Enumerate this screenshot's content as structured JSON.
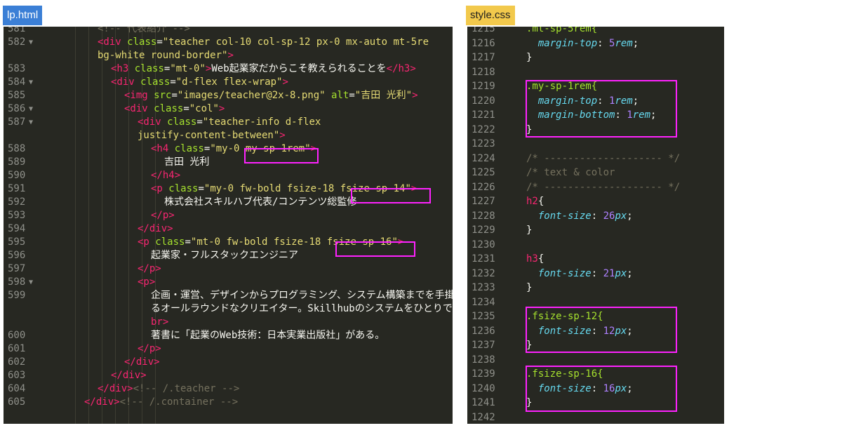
{
  "tabs": {
    "left": "lp.html",
    "right": "style.css"
  },
  "html_lines": [
    {
      "n": "581",
      "fold": "",
      "indent": 2,
      "tokens": [
        [
          "cm",
          "<!-- 代表紹介 -->"
        ]
      ]
    },
    {
      "n": "582",
      "fold": "▼",
      "indent": 2,
      "tokens": [
        [
          "tag",
          "<div"
        ],
        [
          "txt",
          " "
        ],
        [
          "attr",
          "class"
        ],
        [
          "txt",
          "="
        ],
        [
          "str",
          "\"teacher col-10 col-sp-12 px-0 mx-auto mt-5re"
        ]
      ]
    },
    {
      "n": "",
      "fold": "",
      "indent": 2,
      "tokens": [
        [
          "str",
          "bg-white round-border\""
        ],
        [
          "tag",
          ">"
        ]
      ]
    },
    {
      "n": "583",
      "fold": "",
      "indent": 3,
      "tokens": [
        [
          "tag",
          "<h3"
        ],
        [
          "txt",
          " "
        ],
        [
          "attr",
          "class"
        ],
        [
          "txt",
          "="
        ],
        [
          "str",
          "\"mt-0\""
        ],
        [
          "tag",
          ">"
        ],
        [
          "txt",
          "Web起業家だからこそ教えられることを"
        ],
        [
          "tag",
          "</h3>"
        ]
      ]
    },
    {
      "n": "584",
      "fold": "▼",
      "indent": 3,
      "tokens": [
        [
          "tag",
          "<div"
        ],
        [
          "txt",
          " "
        ],
        [
          "attr",
          "class"
        ],
        [
          "txt",
          "="
        ],
        [
          "str",
          "\"d-flex flex-wrap\""
        ],
        [
          "tag",
          ">"
        ]
      ]
    },
    {
      "n": "585",
      "fold": "",
      "indent": 4,
      "tokens": [
        [
          "tag",
          "<img"
        ],
        [
          "txt",
          " "
        ],
        [
          "attr",
          "src"
        ],
        [
          "txt",
          "="
        ],
        [
          "str",
          "\"images/teacher@2x-8.png\""
        ],
        [
          "txt",
          " "
        ],
        [
          "attr",
          "alt"
        ],
        [
          "txt",
          "="
        ],
        [
          "str",
          "\"吉田 光利\""
        ],
        [
          "tag",
          ">"
        ]
      ]
    },
    {
      "n": "586",
      "fold": "▼",
      "indent": 4,
      "tokens": [
        [
          "tag",
          "<div"
        ],
        [
          "txt",
          " "
        ],
        [
          "attr",
          "class"
        ],
        [
          "txt",
          "="
        ],
        [
          "str",
          "\"col\""
        ],
        [
          "tag",
          ">"
        ]
      ]
    },
    {
      "n": "587",
      "fold": "▼",
      "indent": 5,
      "tokens": [
        [
          "tag",
          "<div"
        ],
        [
          "txt",
          " "
        ],
        [
          "attr",
          "class"
        ],
        [
          "txt",
          "="
        ],
        [
          "str",
          "\"teacher-info d-flex"
        ]
      ]
    },
    {
      "n": "",
      "fold": "",
      "indent": 5,
      "tokens": [
        [
          "str",
          "justify-content-between\""
        ],
        [
          "tag",
          ">"
        ]
      ]
    },
    {
      "n": "588",
      "fold": "",
      "indent": 6,
      "tokens": [
        [
          "tag",
          "<h4"
        ],
        [
          "txt",
          " "
        ],
        [
          "attr",
          "class"
        ],
        [
          "txt",
          "="
        ],
        [
          "str",
          "\"my-0 my-sp-1rem\""
        ],
        [
          "tag",
          ">"
        ]
      ]
    },
    {
      "n": "589",
      "fold": "",
      "indent": 7,
      "tokens": [
        [
          "txt",
          "吉田 光利"
        ]
      ]
    },
    {
      "n": "590",
      "fold": "",
      "indent": 6,
      "tokens": [
        [
          "tag",
          "</h4>"
        ]
      ]
    },
    {
      "n": "591",
      "fold": "",
      "indent": 6,
      "tokens": [
        [
          "tag",
          "<p"
        ],
        [
          "txt",
          " "
        ],
        [
          "attr",
          "class"
        ],
        [
          "txt",
          "="
        ],
        [
          "str",
          "\"my-0 fw-bold fsize-18 fsize-sp-14\""
        ],
        [
          "tag",
          ">"
        ]
      ]
    },
    {
      "n": "592",
      "fold": "",
      "indent": 7,
      "tokens": [
        [
          "txt",
          "株式会社スキルハブ代表/コンテンツ総監修"
        ]
      ]
    },
    {
      "n": "593",
      "fold": "",
      "indent": 6,
      "tokens": [
        [
          "tag",
          "</p>"
        ]
      ]
    },
    {
      "n": "594",
      "fold": "",
      "indent": 5,
      "tokens": [
        [
          "tag",
          "</div>"
        ]
      ]
    },
    {
      "n": "595",
      "fold": "",
      "indent": 5,
      "tokens": [
        [
          "tag",
          "<p"
        ],
        [
          "txt",
          " "
        ],
        [
          "attr",
          "class"
        ],
        [
          "txt",
          "="
        ],
        [
          "str",
          "\"mt-0 fw-bold fsize-18 fsize-sp-16\""
        ],
        [
          "tag",
          ">"
        ]
      ]
    },
    {
      "n": "596",
      "fold": "",
      "indent": 6,
      "tokens": [
        [
          "txt",
          "起業家・フルスタックエンジニア"
        ]
      ]
    },
    {
      "n": "597",
      "fold": "",
      "indent": 5,
      "tokens": [
        [
          "tag",
          "</p>"
        ]
      ]
    },
    {
      "n": "598",
      "fold": "▼",
      "indent": 5,
      "tokens": [
        [
          "tag",
          "<p>"
        ]
      ]
    },
    {
      "n": "599",
      "fold": "",
      "indent": 6,
      "tokens": [
        [
          "txt",
          "企画・運営、デザインからプログラミング、システム構築までを手掛けて"
        ]
      ]
    },
    {
      "n": "",
      "fold": "",
      "indent": 6,
      "tokens": [
        [
          "txt",
          "るオールラウンドなクリエイター。Skillhubのシステムをひとりで構築。"
        ]
      ]
    },
    {
      "n": "",
      "fold": "",
      "indent": 6,
      "tokens": [
        [
          "tag",
          "br"
        ],
        [
          "tag",
          ">"
        ]
      ]
    },
    {
      "n": "600",
      "fold": "",
      "indent": 6,
      "tokens": [
        [
          "txt",
          "著書に「起業のWeb技術：日本実業出版社」がある。"
        ]
      ]
    },
    {
      "n": "601",
      "fold": "",
      "indent": 5,
      "tokens": [
        [
          "tag",
          "</p>"
        ]
      ]
    },
    {
      "n": "602",
      "fold": "",
      "indent": 4,
      "tokens": [
        [
          "tag",
          "</div>"
        ]
      ]
    },
    {
      "n": "603",
      "fold": "",
      "indent": 3,
      "tokens": [
        [
          "tag",
          "</div>"
        ]
      ]
    },
    {
      "n": "604",
      "fold": "",
      "indent": 2,
      "tokens": [
        [
          "tag",
          "</div>"
        ],
        [
          "cm",
          "<!-- /.teacher -->"
        ]
      ]
    },
    {
      "n": "605",
      "fold": "",
      "indent": 1,
      "tokens": [
        [
          "tag",
          "</div>"
        ],
        [
          "cm",
          "<!-- /.container -->"
        ]
      ]
    }
  ],
  "css_lines": [
    {
      "n": "1215",
      "tokens": [
        [
          "sel",
          ".mt-sp-5rem{"
        ]
      ]
    },
    {
      "n": "1216",
      "tokens": [
        [
          "txt",
          "  "
        ],
        [
          "prop",
          "margin-top"
        ],
        [
          "txt",
          ": "
        ],
        [
          "num",
          "5"
        ],
        [
          "prop",
          "rem"
        ],
        [
          "txt",
          ";"
        ]
      ]
    },
    {
      "n": "1217",
      "tokens": [
        [
          "txt",
          "}"
        ]
      ]
    },
    {
      "n": "1218",
      "tokens": []
    },
    {
      "n": "1219",
      "tokens": [
        [
          "sel",
          ".my-sp-1rem{"
        ]
      ]
    },
    {
      "n": "1220",
      "tokens": [
        [
          "txt",
          "  "
        ],
        [
          "prop",
          "margin-top"
        ],
        [
          "txt",
          ": "
        ],
        [
          "num",
          "1"
        ],
        [
          "prop",
          "rem"
        ],
        [
          "txt",
          ";"
        ]
      ]
    },
    {
      "n": "1221",
      "tokens": [
        [
          "txt",
          "  "
        ],
        [
          "prop",
          "margin-bottom"
        ],
        [
          "txt",
          ": "
        ],
        [
          "num",
          "1"
        ],
        [
          "prop",
          "rem"
        ],
        [
          "txt",
          ";"
        ]
      ]
    },
    {
      "n": "1222",
      "tokens": [
        [
          "txt",
          "}"
        ]
      ]
    },
    {
      "n": "1223",
      "tokens": []
    },
    {
      "n": "1224",
      "tokens": [
        [
          "cm",
          "/* -------------------- */"
        ]
      ]
    },
    {
      "n": "1225",
      "tokens": [
        [
          "cm",
          "/* text & color"
        ]
      ]
    },
    {
      "n": "1226",
      "tokens": [
        [
          "cm",
          "/* -------------------- */"
        ]
      ]
    },
    {
      "n": "1227",
      "tokens": [
        [
          "tag",
          "h2"
        ],
        [
          "txt",
          "{"
        ]
      ]
    },
    {
      "n": "1228",
      "tokens": [
        [
          "txt",
          "  "
        ],
        [
          "prop",
          "font-size"
        ],
        [
          "txt",
          ": "
        ],
        [
          "num",
          "26"
        ],
        [
          "prop",
          "px"
        ],
        [
          "txt",
          ";"
        ]
      ]
    },
    {
      "n": "1229",
      "tokens": [
        [
          "txt",
          "}"
        ]
      ]
    },
    {
      "n": "1230",
      "tokens": []
    },
    {
      "n": "1231",
      "tokens": [
        [
          "tag",
          "h3"
        ],
        [
          "txt",
          "{"
        ]
      ]
    },
    {
      "n": "1232",
      "tokens": [
        [
          "txt",
          "  "
        ],
        [
          "prop",
          "font-size"
        ],
        [
          "txt",
          ": "
        ],
        [
          "num",
          "21"
        ],
        [
          "prop",
          "px"
        ],
        [
          "txt",
          ";"
        ]
      ]
    },
    {
      "n": "1233",
      "tokens": [
        [
          "txt",
          "}"
        ]
      ]
    },
    {
      "n": "1234",
      "tokens": []
    },
    {
      "n": "1235",
      "tokens": [
        [
          "sel",
          ".fsize-sp-12{"
        ]
      ]
    },
    {
      "n": "1236",
      "tokens": [
        [
          "txt",
          "  "
        ],
        [
          "prop",
          "font-size"
        ],
        [
          "txt",
          ": "
        ],
        [
          "num",
          "12"
        ],
        [
          "prop",
          "px"
        ],
        [
          "txt",
          ";"
        ]
      ]
    },
    {
      "n": "1237",
      "tokens": [
        [
          "txt",
          "}"
        ]
      ]
    },
    {
      "n": "1238",
      "tokens": []
    },
    {
      "n": "1239",
      "tokens": [
        [
          "sel",
          ".fsize-sp-16{"
        ]
      ]
    },
    {
      "n": "1240",
      "tokens": [
        [
          "txt",
          "  "
        ],
        [
          "prop",
          "font-size"
        ],
        [
          "txt",
          ": "
        ],
        [
          "num",
          "16"
        ],
        [
          "prop",
          "px"
        ],
        [
          "txt",
          ";"
        ]
      ]
    },
    {
      "n": "1241",
      "tokens": [
        [
          "txt",
          "}"
        ]
      ]
    },
    {
      "n": "1242",
      "tokens": []
    }
  ],
  "highlight_color": "#ff22ff"
}
